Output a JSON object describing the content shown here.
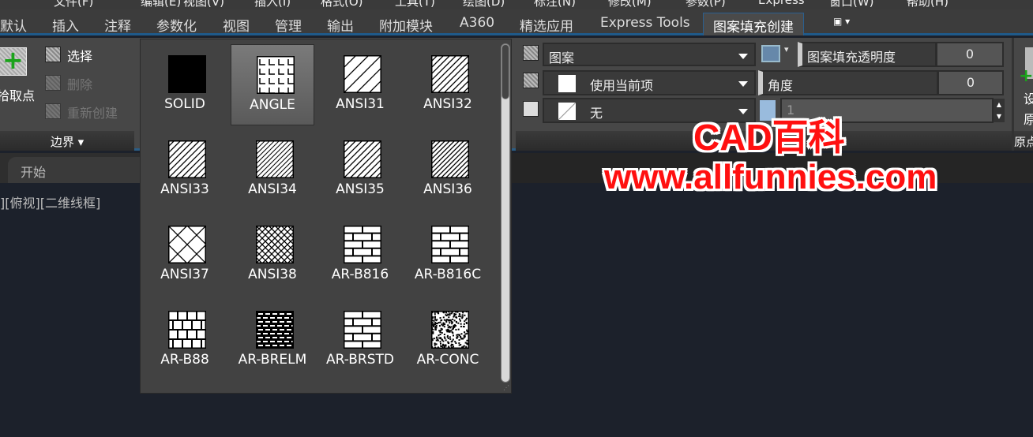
{
  "menubar": [
    "文件(F)",
    "编辑(E)",
    "视图(V)",
    "插入(I)",
    "格式(O)",
    "工具(T)",
    "绘图(D)",
    "标注(N)",
    "修改(M)",
    "参数(P)",
    "Express",
    "窗口(W)",
    "帮助(H)"
  ],
  "ribbon_tabs": [
    {
      "label": "默认"
    },
    {
      "label": "插入"
    },
    {
      "label": "注释"
    },
    {
      "label": "参数化"
    },
    {
      "label": "视图"
    },
    {
      "label": "管理"
    },
    {
      "label": "输出"
    },
    {
      "label": "附加模块"
    },
    {
      "label": "A360"
    },
    {
      "label": "精选应用"
    },
    {
      "label": "Express Tools"
    },
    {
      "label": "图案填充创建",
      "active": true
    }
  ],
  "boundary": {
    "pick_points": "拾取点",
    "select": "选择",
    "remove": "删除",
    "recreate": "重新创建",
    "panel_label": "边界"
  },
  "properties": {
    "type": "图案",
    "color": "使用当前项",
    "background": "无",
    "transparency_label": "图案填充透明度",
    "transparency": "0",
    "angle_label": "角度",
    "angle": "0",
    "scale": "1"
  },
  "origin": {
    "button_1": "设",
    "button_2": "原",
    "panel_label": "原点"
  },
  "doc_tab": "开始",
  "viewport_label": "][俯视][二维线框]",
  "patterns": [
    {
      "name": "SOLID",
      "kind": "solid"
    },
    {
      "name": "ANGLE",
      "kind": "angle",
      "selected": true
    },
    {
      "name": "ANSI31",
      "kind": "diag"
    },
    {
      "name": "ANSI32",
      "kind": "diag2"
    },
    {
      "name": "ANSI33",
      "kind": "diagdash"
    },
    {
      "name": "ANSI34",
      "kind": "diag3"
    },
    {
      "name": "ANSI35",
      "kind": "diagdot"
    },
    {
      "name": "ANSI36",
      "kind": "diagdash2"
    },
    {
      "name": "ANSI37",
      "kind": "cross"
    },
    {
      "name": "ANSI38",
      "kind": "cross2"
    },
    {
      "name": "AR-B816",
      "kind": "brick"
    },
    {
      "name": "AR-B816C",
      "kind": "brick"
    },
    {
      "name": "AR-B88",
      "kind": "brick2"
    },
    {
      "name": "AR-BRELM",
      "kind": "brelm"
    },
    {
      "name": "AR-BRSTD",
      "kind": "brick3"
    },
    {
      "name": "AR-CONC",
      "kind": "conc"
    }
  ],
  "watermark": {
    "line1": "CAD百科",
    "line2": "www.allfunnies.com"
  },
  "colors": {
    "accent": "#1f5a8a",
    "watermark": "#ff1010",
    "ribbon": "#474747",
    "viewport": "#1c212b"
  }
}
